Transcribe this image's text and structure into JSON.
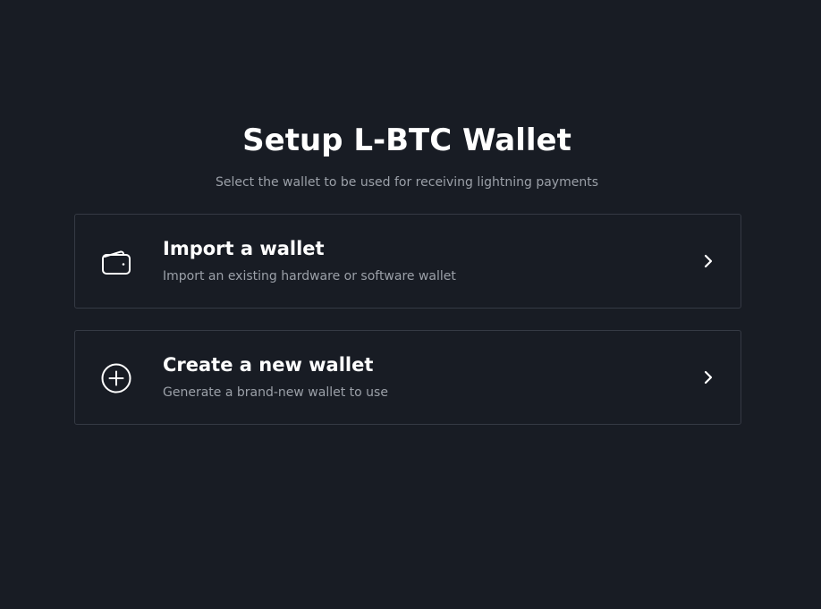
{
  "header": {
    "title": "Setup L-BTC Wallet",
    "subtitle": "Select the wallet to be used for receiving lightning payments"
  },
  "options": [
    {
      "title": "Import a wallet",
      "description": "Import an existing hardware or software wallet",
      "icon": "wallet-icon"
    },
    {
      "title": "Create a new wallet",
      "description": "Generate a brand-new wallet to use",
      "icon": "plus-circle-icon"
    }
  ],
  "colors": {
    "background": "#181c24",
    "card_border": "#353a44",
    "text_primary": "#ffffff",
    "text_secondary": "#9ba0a8"
  }
}
